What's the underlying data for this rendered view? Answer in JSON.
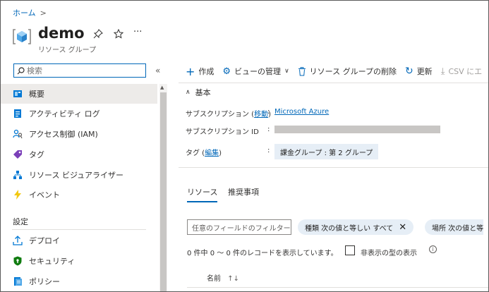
{
  "breadcrumb": {
    "home": "ホーム",
    "separator": ">"
  },
  "header": {
    "title": "demo",
    "subtitle": "リソース グループ",
    "pin_icon": "pin-icon",
    "star_icon": "star-icon",
    "more_label": "···"
  },
  "sidebar": {
    "search_placeholder": "検索",
    "collapse_label": "«",
    "items": [
      {
        "label": "概要",
        "icon": "overview-icon",
        "color": "#0078d4"
      },
      {
        "label": "アクティビティ ログ",
        "icon": "activity-log-icon",
        "color": "#0078d4"
      },
      {
        "label": "アクセス制御 (IAM)",
        "icon": "iam-icon",
        "color": "#0078d4"
      },
      {
        "label": "タグ",
        "icon": "tag-icon",
        "color": "#7b3fb8"
      },
      {
        "label": "リソース ビジュアライザー",
        "icon": "visualizer-icon",
        "color": "#0078d4"
      },
      {
        "label": "イベント",
        "icon": "events-icon",
        "color": "#f2c811"
      }
    ],
    "section_settings": "設定",
    "settings_items": [
      {
        "label": "デプロイ",
        "icon": "deploy-icon",
        "color": "#0078d4"
      },
      {
        "label": "セキュリティ",
        "icon": "security-icon",
        "color": "#107c10"
      },
      {
        "label": "ポリシー",
        "icon": "policy-icon",
        "color": "#0078d4"
      }
    ]
  },
  "toolbar": {
    "create": "作成",
    "manage_view": "ビューの管理",
    "delete_rg": "リソース グループの削除",
    "refresh": "更新",
    "export_csv": "CSV にエ"
  },
  "essentials": {
    "heading": "基本",
    "subscription_label": "サブスクリプション (",
    "subscription_move": "移動",
    "subscription_label_end": ")",
    "subscription_value": "Microsoft Azure",
    "subscription_id_label": "サブスクリプション ID",
    "tags_label": "タグ (",
    "tags_edit": "編集",
    "tags_label_end": ")",
    "tag_value": "課金グループ : 第 2 グループ",
    "colon": ":"
  },
  "tabs": {
    "resources": "リソース",
    "recommendations": "推奨事項"
  },
  "filters": {
    "placeholder": "任意のフィールドのフィルター...",
    "type_filter": "種類 次の値と等しい すべて",
    "location_filter": "場所 次の値と等"
  },
  "results": {
    "count_text": "0 件中 0 ～ 0 件のレコードを表示しています。",
    "hidden_types_label": "非表示の型の表示",
    "name_column": "名前"
  },
  "colors": {
    "accent": "#0067b8",
    "pill": "#e6eef6"
  }
}
